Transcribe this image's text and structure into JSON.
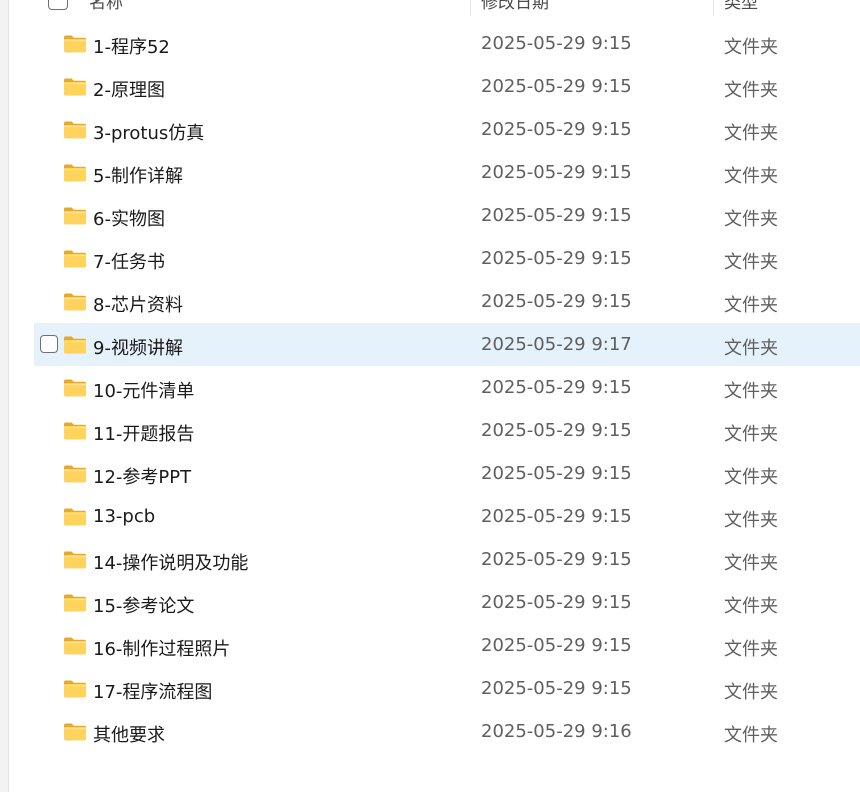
{
  "header": {
    "name_label": "名称",
    "date_label": "修改日期",
    "type_label": "类型"
  },
  "files": [
    {
      "name": "1-程序52",
      "date": "2025-05-29 9:15",
      "type": "文件夹",
      "selected": false
    },
    {
      "name": "2-原理图",
      "date": "2025-05-29 9:15",
      "type": "文件夹",
      "selected": false
    },
    {
      "name": "3-protus仿真",
      "date": "2025-05-29 9:15",
      "type": "文件夹",
      "selected": false
    },
    {
      "name": "5-制作详解",
      "date": "2025-05-29 9:15",
      "type": "文件夹",
      "selected": false
    },
    {
      "name": "6-实物图",
      "date": "2025-05-29 9:15",
      "type": "文件夹",
      "selected": false
    },
    {
      "name": "7-任务书",
      "date": "2025-05-29 9:15",
      "type": "文件夹",
      "selected": false
    },
    {
      "name": "8-芯片资料",
      "date": "2025-05-29 9:15",
      "type": "文件夹",
      "selected": false
    },
    {
      "name": "9-视频讲解",
      "date": "2025-05-29 9:17",
      "type": "文件夹",
      "selected": true
    },
    {
      "name": "10-元件清单",
      "date": "2025-05-29 9:15",
      "type": "文件夹",
      "selected": false
    },
    {
      "name": "11-开题报告",
      "date": "2025-05-29 9:15",
      "type": "文件夹",
      "selected": false
    },
    {
      "name": "12-参考PPT",
      "date": "2025-05-29 9:15",
      "type": "文件夹",
      "selected": false
    },
    {
      "name": "13-pcb",
      "date": "2025-05-29 9:15",
      "type": "文件夹",
      "selected": false
    },
    {
      "name": "14-操作说明及功能",
      "date": "2025-05-29 9:15",
      "type": "文件夹",
      "selected": false
    },
    {
      "name": "15-参考论文",
      "date": "2025-05-29 9:15",
      "type": "文件夹",
      "selected": false
    },
    {
      "name": "16-制作过程照片",
      "date": "2025-05-29 9:15",
      "type": "文件夹",
      "selected": false
    },
    {
      "name": "17-程序流程图",
      "date": "2025-05-29 9:15",
      "type": "文件夹",
      "selected": false
    },
    {
      "name": "其他要求",
      "date": "2025-05-29 9:16",
      "type": "文件夹",
      "selected": false
    }
  ],
  "colors": {
    "selection": "#e5f1fb",
    "folder": "#f5c24a"
  },
  "icons": {
    "folder": "folder-icon"
  }
}
